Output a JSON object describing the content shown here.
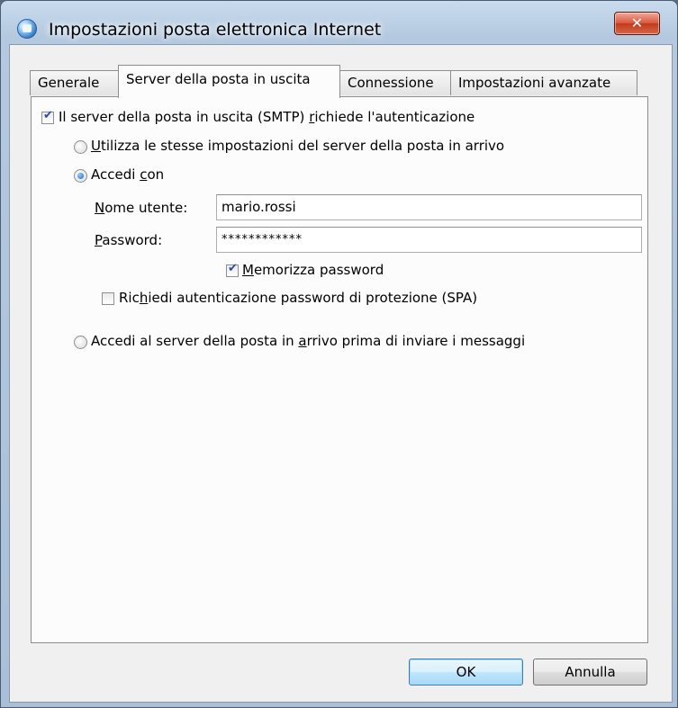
{
  "window": {
    "title": "Impostazioni posta elettronica Internet",
    "close_glyph": "✕"
  },
  "tabs": [
    {
      "label": "Generale",
      "active": false
    },
    {
      "label": "Server della posta in uscita",
      "active": true
    },
    {
      "label": "Connessione",
      "active": false
    },
    {
      "label": "Impostazioni avanzate",
      "active": false
    }
  ],
  "smtp_auth": {
    "checked": true,
    "label_pre": "Il server della posta in uscita (SMTP) ",
    "label_key": "r",
    "label_post": "ichiede l'autenticazione"
  },
  "option_same": {
    "selected": false,
    "label_key": "U",
    "label_post": "tilizza le stesse impostazioni del server della posta in arrivo"
  },
  "option_login": {
    "selected": true,
    "label_pre": "Accedi ",
    "label_key": "c",
    "label_post": "on"
  },
  "username": {
    "label_key": "N",
    "label_post": "ome utente:",
    "value": "mario.rossi"
  },
  "password": {
    "label_key": "P",
    "label_post": "assword:",
    "value": "************"
  },
  "remember_password": {
    "checked": true,
    "label_key": "M",
    "label_post": "emorizza password"
  },
  "spa": {
    "checked": false,
    "label_pre": "Ric",
    "label_key": "h",
    "label_post": "iedi autenticazione password di protezione (SPA)"
  },
  "option_incoming_first": {
    "selected": false,
    "label_pre": "Accedi al server della posta in ",
    "label_key": "a",
    "label_post": "rrivo prima di inviare i messaggi"
  },
  "buttons": {
    "ok": "OK",
    "cancel": "Annulla"
  },
  "colors": {
    "title_close": "#c23a1e",
    "default_button_border": "#3c7fb1"
  },
  "icons": {
    "app": "mail-settings-icon",
    "close": "close-icon",
    "check": "checkmark-icon"
  }
}
